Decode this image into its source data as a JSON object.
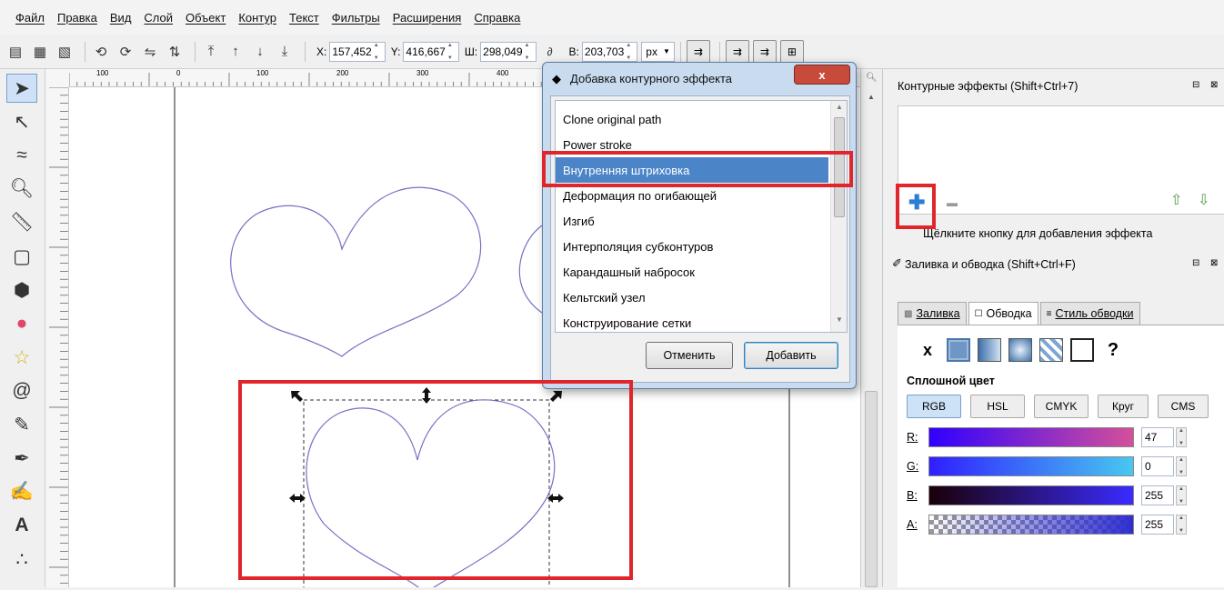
{
  "menu": [
    "Файл",
    "Правка",
    "Вид",
    "Слой",
    "Объект",
    "Контур",
    "Текст",
    "Фильтры",
    "Расширения",
    "Справка"
  ],
  "toolbar": {
    "x_label": "X:",
    "x_value": "157,452",
    "y_label": "Y:",
    "y_value": "416,667",
    "w_label": "Ш:",
    "w_value": "298,049",
    "lock_icon": "chain-icon",
    "h_label": "В:",
    "h_value": "203,703",
    "unit": "px"
  },
  "ruler_labels": [
    "100",
    "0",
    "100",
    "200",
    "300",
    "400"
  ],
  "dialog": {
    "title": "Добавка контурного эффекта",
    "close": "x",
    "items": [
      "Clone original path",
      "Power stroke",
      "Внутренняя штриховка",
      "Деформация по огибающей",
      "Изгиб",
      "Интерполяция субконтуров",
      "Карандашный набросок",
      "Кельтский узел",
      "Конструирование сетки"
    ],
    "selected_index": 2,
    "cancel": "Отменить",
    "add": "Добавить"
  },
  "effects_panel": {
    "title": "Контурные эффекты (Shift+Ctrl+7)",
    "hint": "Щёлкните кнопку для добавления эффекта"
  },
  "fill_panel": {
    "title": "Заливка и обводка (Shift+Ctrl+F)",
    "tabs": [
      "Заливка",
      "Обводка",
      "Стиль обводки"
    ],
    "selected_tab": 1,
    "paint_types": [
      "x",
      "?"
    ],
    "flat_color_label": "Сплошной цвет",
    "models": [
      "RGB",
      "HSL",
      "CMYK",
      "Круг",
      "CMS"
    ],
    "selected_model": 0,
    "channels": [
      {
        "label": "R:",
        "value": "47"
      },
      {
        "label": "G:",
        "value": "0"
      },
      {
        "label": "B:",
        "value": "255"
      },
      {
        "label": "A:",
        "value": "255"
      }
    ]
  },
  "colors": {
    "accent_red": "#e0262b",
    "selection_blue": "#4c84c8",
    "heart_stroke": "#7570c4"
  }
}
